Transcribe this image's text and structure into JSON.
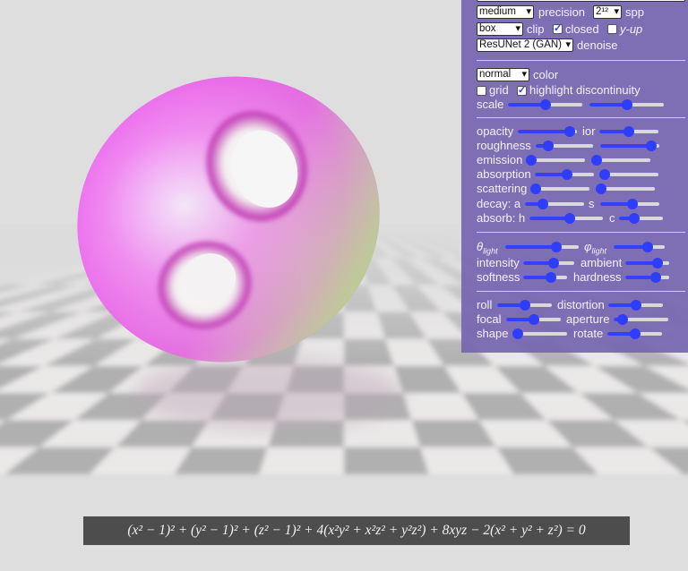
{
  "equation": {
    "text": "(x² − 1)² + (y² − 1)² + (z² − 1)² + 4(x²y² + x²z² + y²z²) + 8xyz − 2(x² + y² + z²) = 0"
  },
  "render": {
    "precision_select": "medium",
    "precision_label": "precision",
    "spp_select": "2¹²",
    "spp_label": "spp",
    "clip_select": "box",
    "clip_label": "clip",
    "closed_label": "closed",
    "closed_checked": true,
    "yup_label": "y-up",
    "yup_checked": false,
    "denoise_select": "ResUNet 2 (GAN)",
    "denoise_label": "denoise"
  },
  "color": {
    "mode_select": "normal",
    "color_label": "color",
    "grid_label": "grid",
    "grid_checked": false,
    "highlight_label": "highlight discontinuity",
    "highlight_checked": true,
    "scale_label": "scale",
    "scale_value": 0.5,
    "scale2_value": 0.5
  },
  "material": {
    "opacity_label": "opacity",
    "opacity_value": 0.97,
    "ior_label": "ior",
    "ior_value": 0.5,
    "roughness_label": "roughness",
    "roughness_value": 0.15,
    "roughness2_value": 0.95,
    "emission_label": "emission",
    "emission_value": 0.0,
    "emission2_value": 0.0,
    "absorption_label": "absorption",
    "absorption_value": 0.55,
    "absorption2_value": 0.0,
    "scattering_label": "scattering",
    "scattering_value": 0.0,
    "scattering2_value": 0.0,
    "decay_a_label": "decay: a",
    "decay_a_value": 0.25,
    "s_label": "s",
    "s_value": 0.55,
    "absorb_h_label": "absorb: h",
    "absorb_h_value": 0.55,
    "c_label": "c",
    "c_value": 0.3
  },
  "light": {
    "theta_label": "θ",
    "theta_sub": "light",
    "theta_value": 0.73,
    "phi_label": "φ",
    "phi_sub": "light",
    "phi_value": 0.7,
    "intensity_label": "intensity",
    "intensity_value": 0.62,
    "ambient_label": "ambient",
    "ambient_value": 0.8,
    "softness_label": "softness",
    "softness_value": 0.68,
    "hardness_label": "hardness",
    "hardness_value": 0.76
  },
  "camera": {
    "roll_label": "roll",
    "roll_value": 0.5,
    "distortion_label": "distortion",
    "distortion_value": 0.5,
    "focal_label": "focal",
    "focal_value": 0.5,
    "aperture_label": "aperture",
    "aperture_value": 0.08,
    "shape_label": "shape",
    "shape_value": 0.0,
    "rotate_label": "rotate",
    "rotate_value": 0.5
  }
}
